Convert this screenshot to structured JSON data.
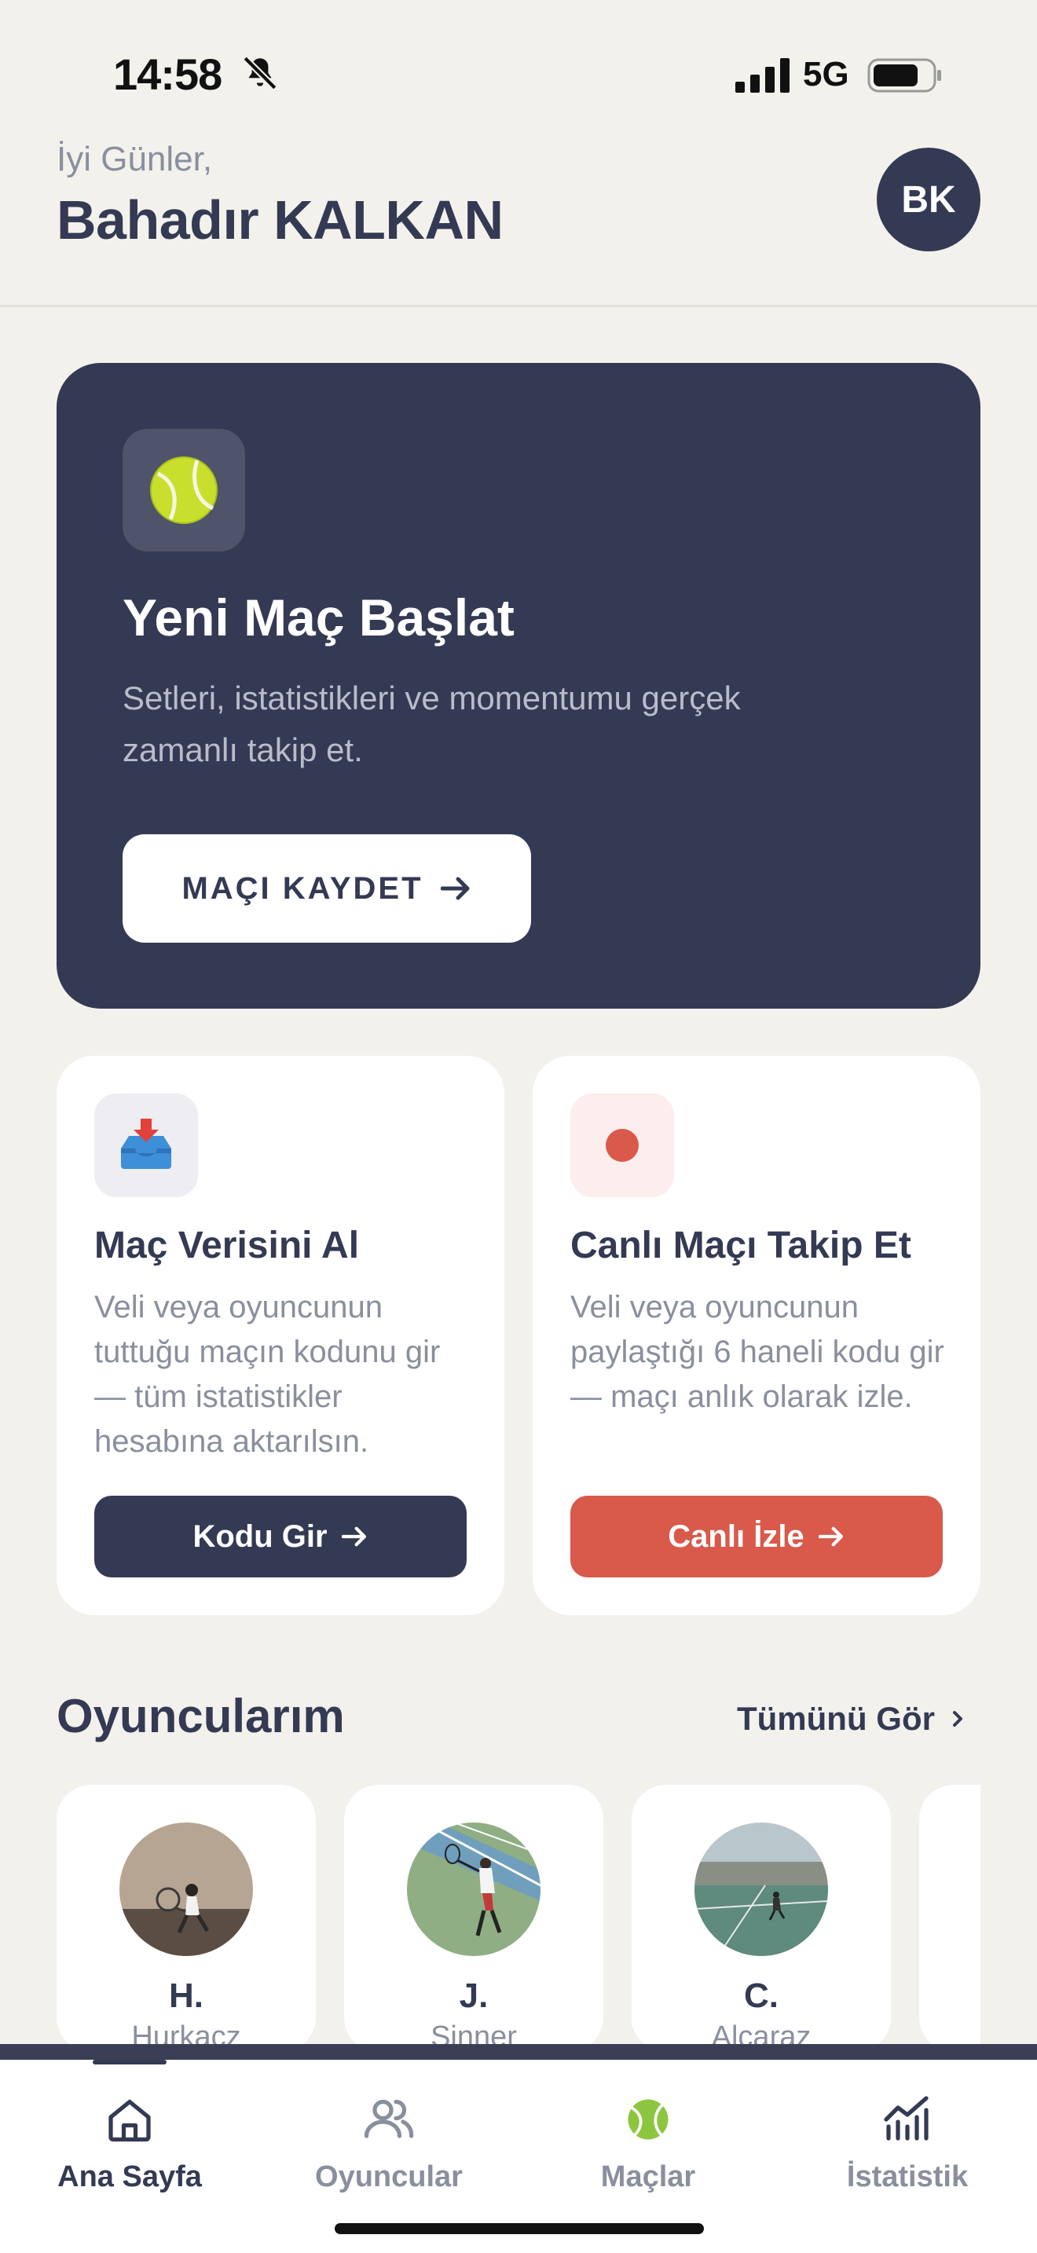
{
  "status_bar": {
    "time": "14:58",
    "network": "5G"
  },
  "header": {
    "greeting": "İyi Günler,",
    "user_name": "Bahadır KALKAN",
    "avatar_initials": "BK"
  },
  "hero": {
    "title": "Yeni Maç Başlat",
    "subtitle": "Setleri, istatistikleri ve momentumu gerçek zamanlı takip et.",
    "button_label": "MAÇI KAYDET"
  },
  "cards": [
    {
      "title": "Maç Verisini Al",
      "description": "Veli veya oyuncunun tuttuğu maçın kodunu gir — tüm istatistikler hesabına aktarılsın.",
      "button_label": "Kodu Gir"
    },
    {
      "title": "Canlı Maçı Takip Et",
      "description": "Veli veya oyuncunun paylaştığı 6 haneli kodu gir — maçı anlık olarak izle.",
      "button_label": "Canlı İzle"
    }
  ],
  "players_section": {
    "title": "Oyuncularım",
    "see_all": "Tümünü Gör",
    "players": [
      {
        "initial": "H.",
        "surname": "Hurkacz"
      },
      {
        "initial": "J.",
        "surname": "Sinner"
      },
      {
        "initial": "C.",
        "surname": "Alcaraz"
      }
    ]
  },
  "tab_bar": {
    "tabs": [
      {
        "label": "Ana Sayfa",
        "icon": "home-icon",
        "active": true
      },
      {
        "label": "Oyuncular",
        "icon": "users-icon",
        "active": false
      },
      {
        "label": "Maçlar",
        "icon": "tennis-ball-icon",
        "active": false
      },
      {
        "label": "İstatistik",
        "icon": "chart-icon",
        "active": false
      }
    ]
  },
  "colors": {
    "background": "#f3f1ec",
    "navy": "#343a53",
    "accent_red": "#d9594a",
    "muted_text": "#8a8f9e",
    "tennis_green": "#8cc63f"
  }
}
